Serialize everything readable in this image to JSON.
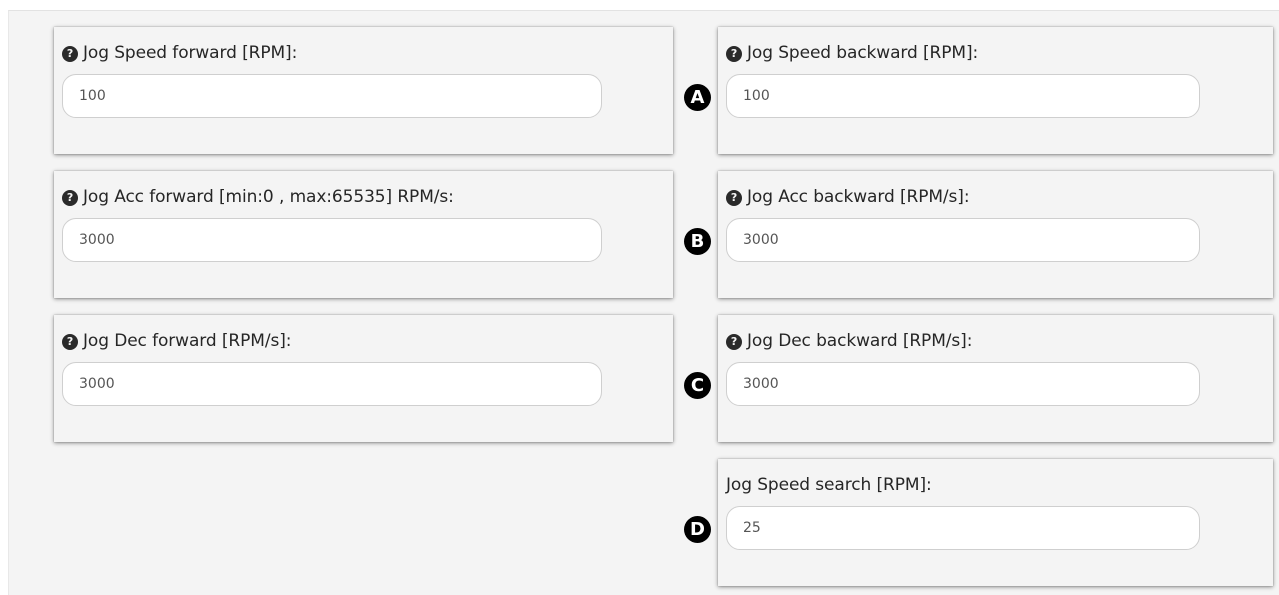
{
  "fields": {
    "jog_speed_forward": {
      "label": "Jog Speed forward [RPM]:",
      "value": "100"
    },
    "jog_speed_backward": {
      "label": "Jog Speed backward [RPM]:",
      "value": "100"
    },
    "jog_acc_forward": {
      "label": "Jog Acc forward [min:0 , max:65535] RPM/s:",
      "value": "3000"
    },
    "jog_acc_backward": {
      "label": "Jog Acc backward [RPM/s]:",
      "value": "3000"
    },
    "jog_dec_forward": {
      "label": "Jog Dec forward [RPM/s]:",
      "value": "3000"
    },
    "jog_dec_backward": {
      "label": "Jog Dec backward [RPM/s]:",
      "value": "3000"
    },
    "jog_speed_search": {
      "label": "Jog Speed search [RPM]:",
      "value": "25"
    }
  },
  "markers": [
    "A",
    "B",
    "C",
    "D"
  ],
  "icons": {
    "help": "question-circle-icon",
    "help_glyph": "?"
  },
  "colors": {
    "panel_bg": "#f4f4f4",
    "marker_bg": "#000000",
    "label_text": "#262626"
  }
}
